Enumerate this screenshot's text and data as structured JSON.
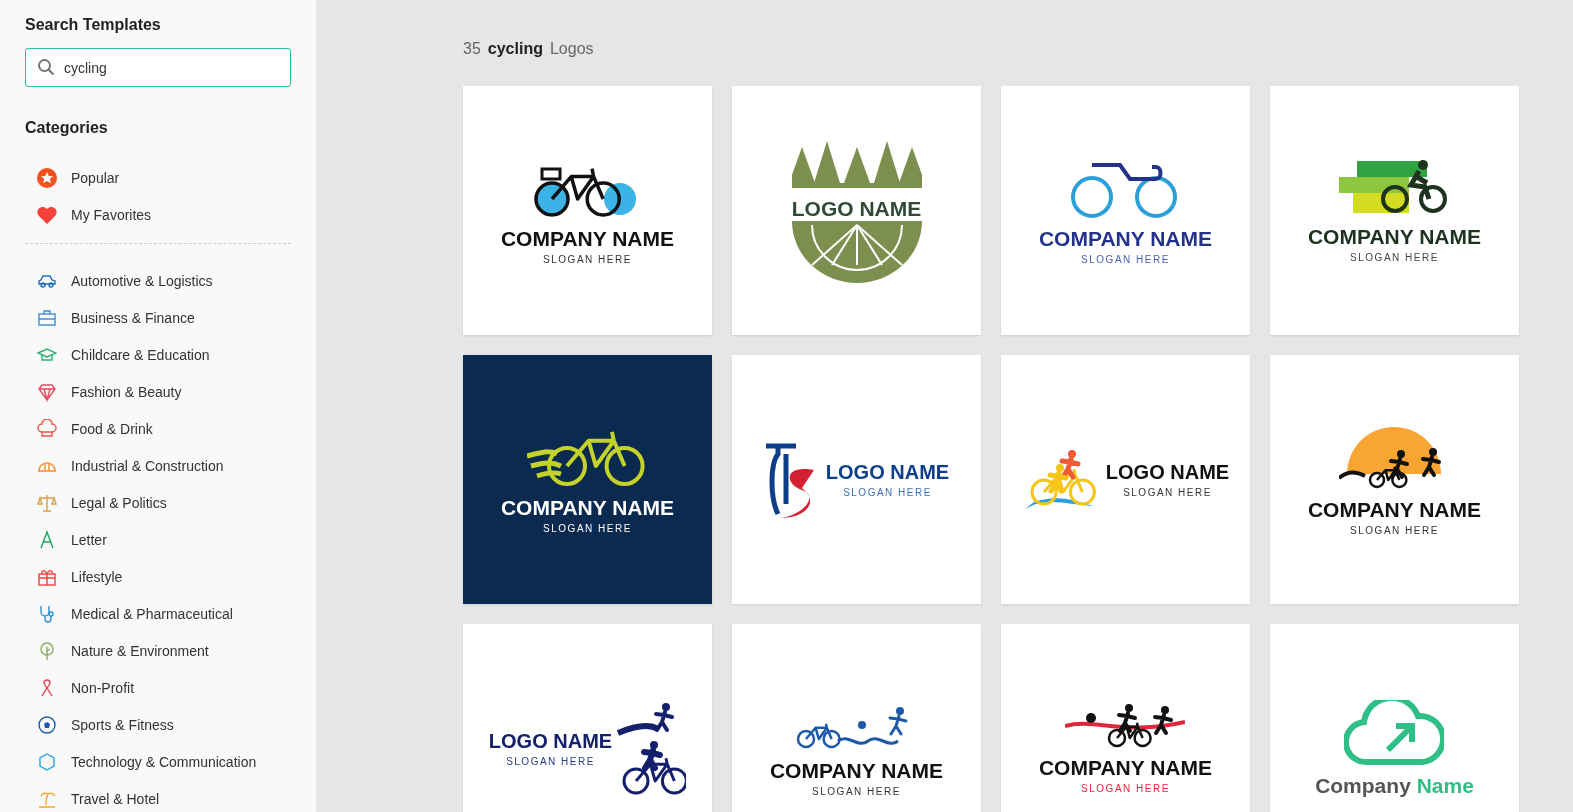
{
  "sidebar": {
    "search_title": "Search Templates",
    "search": {
      "value": "cycling"
    },
    "categories_title": "Categories",
    "quick_links": [
      {
        "label": "Popular",
        "color": "#f4511e"
      },
      {
        "label": "My Favorites",
        "color": "#f44336"
      }
    ],
    "categories": [
      {
        "label": "Automotive & Logistics"
      },
      {
        "label": "Business & Finance"
      },
      {
        "label": "Childcare & Education"
      },
      {
        "label": "Fashion & Beauty"
      },
      {
        "label": "Food & Drink"
      },
      {
        "label": "Industrial & Construction"
      },
      {
        "label": "Legal & Politics"
      },
      {
        "label": "Letter"
      },
      {
        "label": "Lifestyle"
      },
      {
        "label": "Medical & Pharmaceutical"
      },
      {
        "label": "Nature & Environment"
      },
      {
        "label": "Non-Profit"
      },
      {
        "label": "Sports & Fitness"
      },
      {
        "label": "Technology & Communication"
      },
      {
        "label": "Travel & Hotel"
      }
    ]
  },
  "results": {
    "count": "35",
    "query": "cycling",
    "noun": "Logos"
  },
  "logos": [
    {
      "kind": "city-bike",
      "name": "COMPANY NAME",
      "slogan": "SLOGAN HERE"
    },
    {
      "kind": "forest-wheel",
      "name": "LOGO NAME"
    },
    {
      "kind": "road-bike",
      "name": "COMPANY NAME",
      "slogan": "SLOGAN HERE"
    },
    {
      "kind": "cyclist-bars",
      "name": "COMPANY NAME",
      "slogan": "SLOGAN HERE"
    },
    {
      "kind": "flame-bike",
      "name": "COMPANY NAME",
      "slogan": "SLOGAN HERE"
    },
    {
      "kind": "bike-letter",
      "name": "LOGO NAME",
      "slogan": "SLOGAN HERE"
    },
    {
      "kind": "triathlete-splash",
      "name": "LOGO NAME",
      "slogan": "SLOGAN HERE"
    },
    {
      "kind": "triathlon-sun",
      "name": "COMPANY NAME",
      "slogan": "SLOGAN HERE"
    },
    {
      "kind": "triathletes-navy",
      "name": "LOGO NAME",
      "slogan": "SLOGAN HERE"
    },
    {
      "kind": "triathlon-line",
      "name": "COMPANY NAME",
      "slogan": "SLOGAN HERE"
    },
    {
      "kind": "triathlon-ribbon",
      "name": "COMPANY NAME",
      "slogan": "SLOGAN HERE"
    },
    {
      "kind": "cloud-arrow",
      "name": "Company",
      "name_accent": "Name"
    }
  ]
}
